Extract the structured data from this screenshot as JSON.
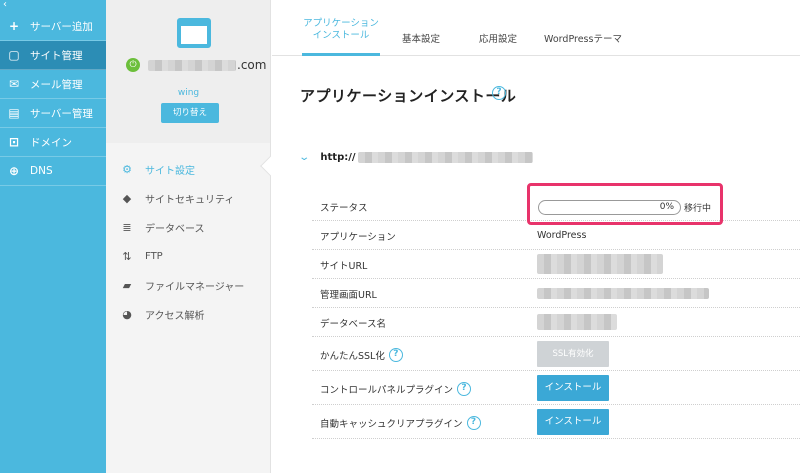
{
  "nav": {
    "collapse_icon": "‹",
    "items": [
      {
        "label": "サーバー追加",
        "icon": "plus-icon",
        "glyph": "+"
      },
      {
        "label": "サイト管理",
        "icon": "window-icon",
        "glyph": "▢"
      },
      {
        "label": "メール管理",
        "icon": "mail-icon",
        "glyph": "✉"
      },
      {
        "label": "サーバー管理",
        "icon": "server-icon",
        "glyph": "▤"
      },
      {
        "label": "ドメイン",
        "icon": "domain-icon",
        "glyph": "⊡"
      },
      {
        "label": "DNS",
        "icon": "globe-icon",
        "glyph": "⊕"
      }
    ]
  },
  "site": {
    "domain_suffix": ".com",
    "server_name": "wing",
    "switch_label": "切り替え",
    "menu": [
      {
        "label": "サイト設定",
        "icon": "gear-icon",
        "glyph": "⚙"
      },
      {
        "label": "サイトセキュリティ",
        "icon": "shield-icon",
        "glyph": "◆"
      },
      {
        "label": "データベース",
        "icon": "database-icon",
        "glyph": "≣"
      },
      {
        "label": "FTP",
        "icon": "transfer-icon",
        "glyph": "⇅"
      },
      {
        "label": "ファイルマネージャー",
        "icon": "folder-icon",
        "glyph": "▰"
      },
      {
        "label": "アクセス解析",
        "icon": "pie-chart-icon",
        "glyph": "◕"
      }
    ]
  },
  "tabs": [
    {
      "label_line1": "アプリケーション",
      "label_line2": "インストール"
    },
    {
      "label_line1": "基本設定",
      "label_line2": ""
    },
    {
      "label_line1": "応用設定",
      "label_line2": ""
    },
    {
      "label_line1": "WordPressテーマ",
      "label_line2": ""
    }
  ],
  "main": {
    "title": "アプリケーションインストール",
    "help_glyph": "?",
    "url_prefix": "http://",
    "rows": {
      "status": {
        "label": "ステータス",
        "progress_text": "0%",
        "progress_fraction": 0,
        "state": "移行中"
      },
      "application": {
        "label": "アプリケーション",
        "value": "WordPress"
      },
      "site_url": {
        "label": "サイトURL"
      },
      "admin_url": {
        "label": "管理画面URL"
      },
      "db_name": {
        "label": "データベース名"
      },
      "ssl": {
        "label": "かんたんSSL化",
        "button": "SSL有効化"
      },
      "cp_plugin": {
        "label": "コントロールパネルプラグイン",
        "button": "インストール"
      },
      "cache_plugin": {
        "label": "自動キャッシュクリアプラグイン",
        "button": "インストール"
      }
    }
  },
  "colors": {
    "accent": "#4bb8de",
    "highlight": "#e8336b",
    "active_nav": "#2c8db5"
  }
}
